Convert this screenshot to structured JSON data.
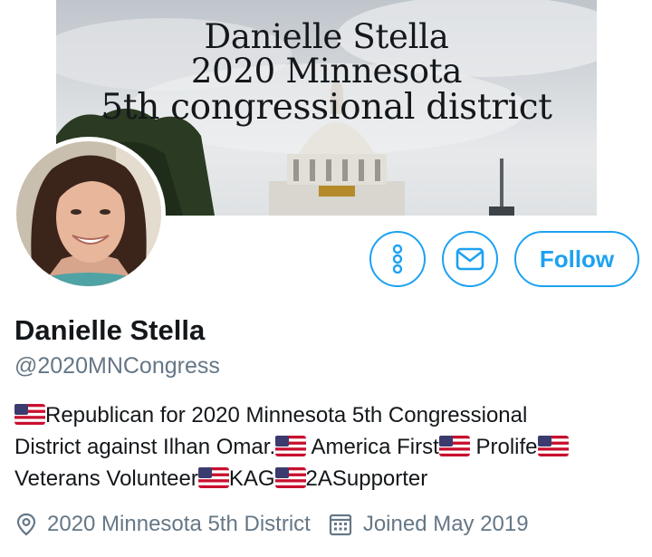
{
  "banner": {
    "line1": "Danielle Stella",
    "line2": "2020 Minnesota",
    "line3": "5th congressional district"
  },
  "actions": {
    "more_icon": "more-vertical-icon",
    "message_icon": "envelope-icon",
    "follow_label": "Follow"
  },
  "profile": {
    "display_name": "Danielle Stella",
    "handle": "@2020MNCongress",
    "bio": {
      "line1": "Republican for 2020 Minnesota 5th Congressional",
      "line2_a": "District against Ilhan Omar.",
      "line2_b": " America First",
      "line2_c": " Prolife",
      "line3_a": "Veterans Volunteer",
      "line3_b": "KAG",
      "line3_c": "2ASupporter"
    },
    "location": "2020 Minnesota 5th District",
    "joined": "Joined May 2019"
  },
  "colors": {
    "accent": "#1da1f2",
    "secondary_text": "#657786",
    "primary_text": "#14171a"
  }
}
